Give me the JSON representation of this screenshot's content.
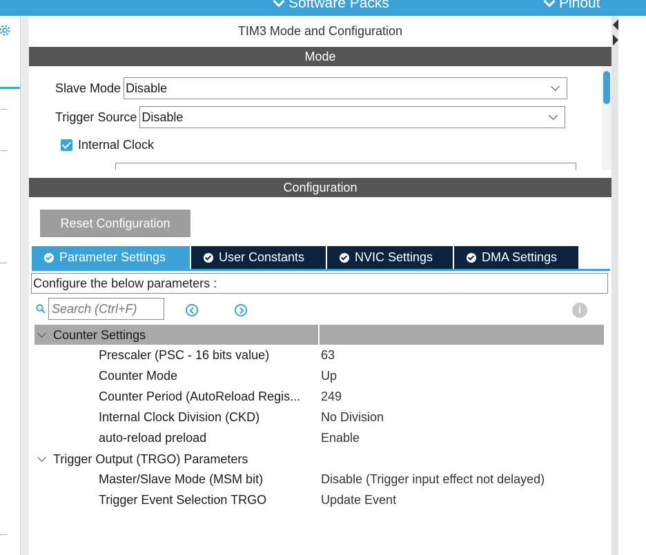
{
  "topbar": {
    "software_packs": "Software Packs",
    "pinout": "Pinout",
    "color": "#3aa2d6"
  },
  "panel": {
    "title": "TIM3 Mode and Configuration",
    "mode_header": "Mode",
    "config_header": "Configuration"
  },
  "mode": {
    "slave_mode_label": "Slave Mode",
    "slave_mode_value": "Disable",
    "trigger_source_label": "Trigger Source",
    "trigger_source_value": "Disable",
    "internal_clock_label": "Internal Clock",
    "internal_clock_checked": true
  },
  "config": {
    "reset_button": "Reset Configuration",
    "tabs": [
      {
        "label": "Parameter Settings",
        "active": true
      },
      {
        "label": "User Constants",
        "active": false
      },
      {
        "label": "NVIC Settings",
        "active": false
      },
      {
        "label": "DMA Settings",
        "active": false
      }
    ],
    "hint": "Configure the below parameters :",
    "search_placeholder": "Search (Ctrl+F)",
    "groups": [
      {
        "name": "Counter Settings",
        "params": [
          {
            "name": "Prescaler (PSC - 16 bits value)",
            "value": "63"
          },
          {
            "name": "Counter Mode",
            "value": "Up"
          },
          {
            "name": "Counter Period (AutoReload Regis...",
            "value": "249"
          },
          {
            "name": "Internal Clock Division (CKD)",
            "value": "No Division"
          },
          {
            "name": "auto-reload preload",
            "value": "Enable"
          }
        ]
      },
      {
        "name": "Trigger Output (TRGO) Parameters",
        "params": [
          {
            "name": "Master/Slave Mode (MSM bit)",
            "value": "Disable (Trigger input effect not delayed)"
          },
          {
            "name": "Trigger Event Selection TRGO",
            "value": "Update Event"
          }
        ]
      }
    ]
  },
  "icons": [
    "gear-icon",
    "chevron-down-icon",
    "check-icon",
    "search-icon",
    "prev-icon",
    "next-icon",
    "info-icon",
    "collapse-icon"
  ]
}
